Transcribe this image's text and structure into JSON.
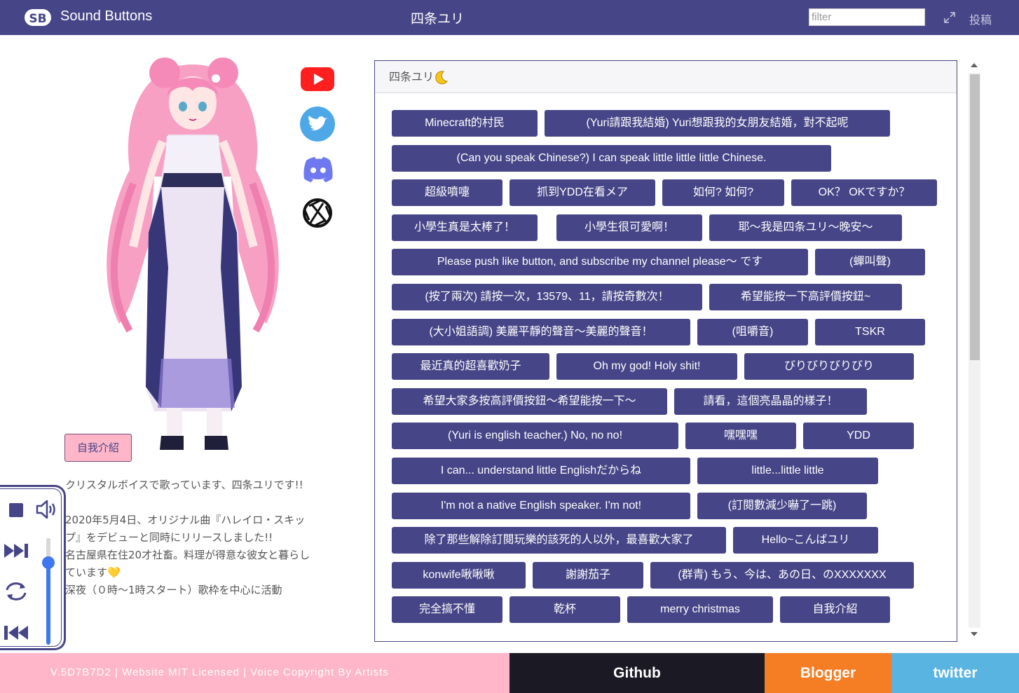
{
  "header": {
    "brand": "Sound Buttons",
    "title": "四条ユリ",
    "filter_placeholder": "filter",
    "post_label": "投稿",
    "bg_color": "#464587"
  },
  "profile": {
    "intro_button": "自我介紹",
    "description": "クリスタルボイスで歌っています、四条ユリです!!\n\n2020年5月4日、オリジナル曲『ハレイロ・スキップ』をデビューと同時にリリースしました!!\n名古屋県在住20才社畜。料理が得意な彼女と暮らしています💛\n深夜（０時～1時スタート）歌枠を中心に活動",
    "social_icons": [
      "youtube-icon",
      "twitter-icon",
      "discord-icon",
      "website-icon"
    ]
  },
  "panel": {
    "title": "四条ユリ",
    "buttons": [
      "Minecraft的村民",
      "(Yuri請跟我結婚) Yuri想跟我的女朋友結婚，對不起呢",
      "(Can you speak Chinese?) I can speak little little little Chinese.",
      "超級噴嚏",
      "抓到YDD在看メア",
      "如何? 如何?",
      "OK？ OKですか？",
      "小學生真是太棒了！",
      "小學生很可愛啊！",
      "耶～我是四条ユリ～晚安～",
      "Please push like button, and subscribe my channel please～ です",
      "(蟬叫聲)",
      "(按了兩次) 請按一次，13579、11，請按奇數次！",
      "希望能按一下高評價按鈕~",
      "(大小姐語調) 美麗平靜的聲音～美麗的聲音！",
      "(咀嚼音)",
      "TSKR",
      "最近真的超喜歡奶子",
      "Oh my god! Holy shit!",
      "びりびりびりびり",
      "希望大家多按高評價按鈕～希望能按一下～",
      "請看，這個亮晶晶的樣子！",
      "(Yuri is english teacher.) No, no no!",
      "嘿嘿嘿",
      "YDD",
      "I can... understand little Englishだからね",
      "little...little little",
      "I'm not a native English speaker. I'm not!",
      "(訂閱數減少嚇了一跳)",
      "除了那些解除訂閱玩樂的該死的人以外，最喜歡大家了",
      "Hello~こんばユリ",
      "konwife啾啾啾",
      "謝謝茄子",
      "(群青) もう、今は、あの日、のXXXXXXX",
      "完全搞不懂",
      "乾杯",
      "merry christmas",
      "自我介紹"
    ]
  },
  "player": {
    "volume": 0.78
  },
  "footer": {
    "version": "V.5D7B7D2 | Website MIT Licensed | Voice Copyright By Artists",
    "github": "Github",
    "blogger": "Blogger",
    "twitter": "twitter"
  }
}
